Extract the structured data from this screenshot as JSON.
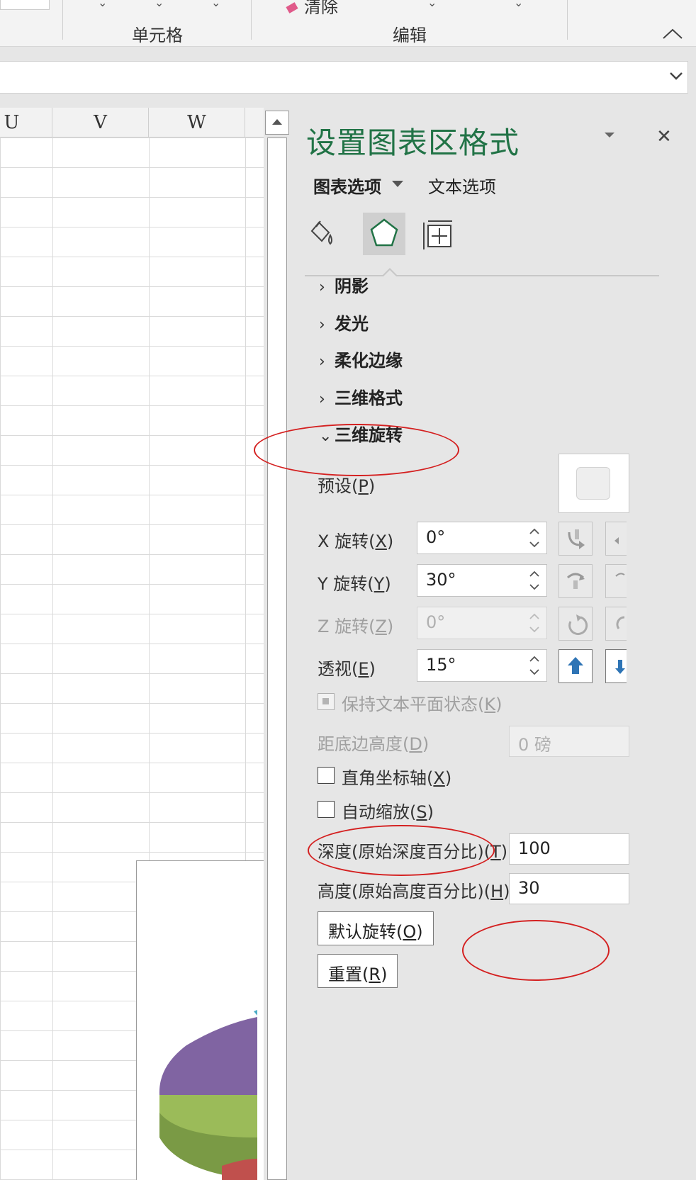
{
  "ribbon": {
    "groups": [
      {
        "label": "单元格"
      },
      {
        "label": "编辑"
      }
    ],
    "clear_label": "清除"
  },
  "sheet": {
    "columns": [
      "U",
      "V",
      "W"
    ]
  },
  "chart": {
    "slice_colors": [
      "#8064a2",
      "#9bbb59",
      "#c0504d",
      "#4bacc6"
    ]
  },
  "pane": {
    "title": "设置图表区格式",
    "tabs": {
      "chart_options": "图表选项",
      "text_options": "文本选项"
    },
    "sections": [
      "阴影",
      "发光",
      "柔化边缘",
      "三维格式",
      "三维旋转"
    ],
    "rotation": {
      "preset_label": "预设(",
      "preset_key": "P",
      "x_label": "X 旋转(",
      "x_key": "X",
      "x_value": "0°",
      "y_label": "Y 旋转(",
      "y_key": "Y",
      "y_value": "30°",
      "z_label": "Z 旋转(",
      "z_key": "Z",
      "z_value": "0°",
      "perspective_label": "透视(",
      "perspective_key": "E",
      "perspective_value": "15°",
      "keep_text_flat_label": "保持文本平面状态(",
      "keep_text_flat_key": "K",
      "distance_label": "距底边高度(",
      "distance_key": "D",
      "distance_value": "0 磅",
      "right_angle_axes_label": "直角坐标轴(",
      "right_angle_axes_key": "X",
      "autoscale_label": "自动缩放(",
      "autoscale_key": "S",
      "depth_label": "深度(原始深度百分比)(",
      "depth_key": "T",
      "depth_value": "100",
      "height_label": "高度(原始高度百分比)(",
      "height_key": "H",
      "height_value": "30",
      "default_rotation_label": "默认旋转(",
      "default_rotation_key": "O",
      "reset_label": "重置(",
      "reset_key": "R",
      "close_paren": ")"
    },
    "accent_color": "#217346"
  },
  "annotations": {
    "color": "#d42020"
  }
}
